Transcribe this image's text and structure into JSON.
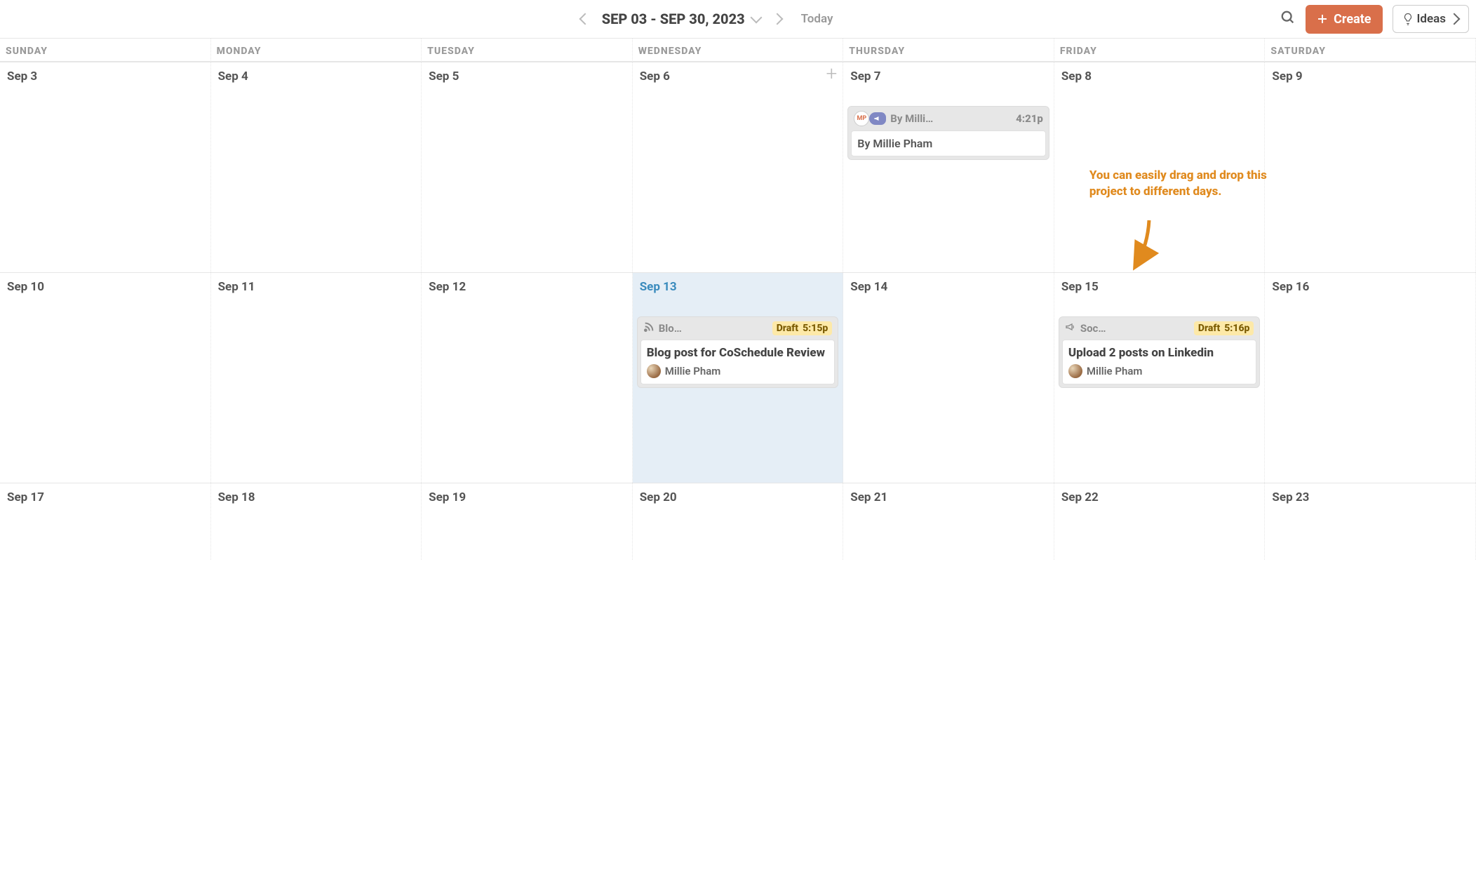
{
  "topbar": {
    "range_label": "SEP 03 - SEP 30, 2023",
    "today_label": "Today",
    "create_label": "Create",
    "ideas_label": "Ideas"
  },
  "day_headers": [
    "SUNDAY",
    "MONDAY",
    "TUESDAY",
    "WEDNESDAY",
    "THURSDAY",
    "FRIDAY",
    "SATURDAY"
  ],
  "weeks": [
    [
      "Sep 3",
      "Sep 4",
      "Sep 5",
      "Sep 6",
      "Sep 7",
      "Sep 8",
      "Sep 9"
    ],
    [
      "Sep 10",
      "Sep 11",
      "Sep 12",
      "Sep 13",
      "Sep 14",
      "Sep 15",
      "Sep 16"
    ],
    [
      "Sep 17",
      "Sep 18",
      "Sep 19",
      "Sep 20",
      "Sep 21",
      "Sep 22",
      "Sep 23"
    ]
  ],
  "today_cell": "Sep 13",
  "hover_add_cell": "Sep 6",
  "callout_text": "You can easily drag and drop this project to different days.",
  "cards": {
    "sep7": {
      "type_short": "By Milli…",
      "time": "4:21p",
      "body_text": "By Millie Pham"
    },
    "sep13": {
      "type_short": "Blo…",
      "status": "Draft",
      "time": "5:15p",
      "title": "Blog post for CoSchedule Review",
      "assignee": "Millie Pham"
    },
    "sep15": {
      "type_short": "Soc…",
      "status": "Draft",
      "time": "5:16p",
      "title": "Upload 2 posts on Linkedin",
      "assignee": "Millie Pham"
    }
  }
}
